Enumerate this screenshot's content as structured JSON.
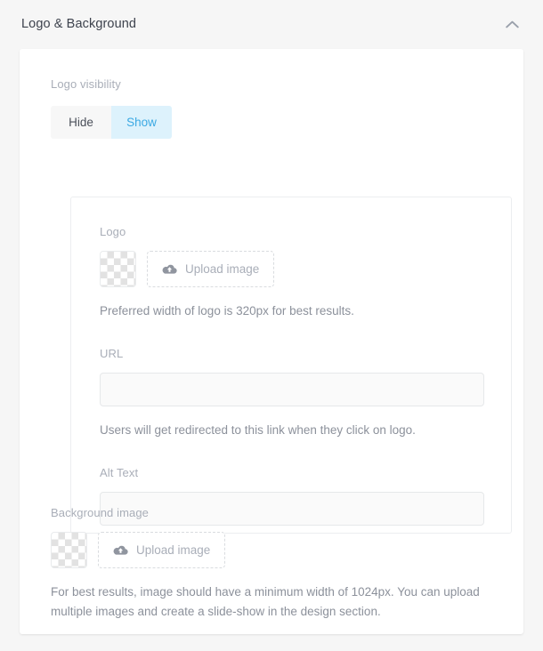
{
  "header": {
    "title": "Logo & Background",
    "collapse_icon": "chevron-up-icon"
  },
  "logo_visibility": {
    "label": "Logo visibility",
    "options": [
      {
        "label": "Hide",
        "selected": false
      },
      {
        "label": "Show",
        "selected": true
      }
    ],
    "selected": "Show"
  },
  "logo": {
    "label": "Logo",
    "thumbnail": "transparent-checkerboard-placeholder",
    "upload_button": {
      "label": "Upload image",
      "icon": "cloud-upload-icon"
    },
    "help_text": "Preferred width of logo is 320px for best results."
  },
  "url": {
    "label": "URL",
    "value": "",
    "placeholder": "",
    "help_text": "Users will get redirected to this link when they click on logo."
  },
  "alt_text": {
    "label": "Alt Text",
    "value": "",
    "placeholder": ""
  },
  "background_image": {
    "label": "Background image",
    "thumbnail": "transparent-checkerboard-placeholder",
    "upload_button": {
      "label": "Upload image",
      "icon": "cloud-upload-icon"
    },
    "help_text": "For best results, image should have a minimum width of 1024px. You can upload multiple images and create a slide-show in the design section."
  },
  "colors": {
    "page_background": "#f6f6f6",
    "card_background": "#ffffff",
    "accent_blue": "#3ba9e3",
    "accent_blue_bg": "#ddf2fc",
    "label_gray": "#a9aeb8",
    "help_gray": "#8c919b",
    "title_dark": "#3d424d",
    "border_gray": "#eceef0"
  }
}
